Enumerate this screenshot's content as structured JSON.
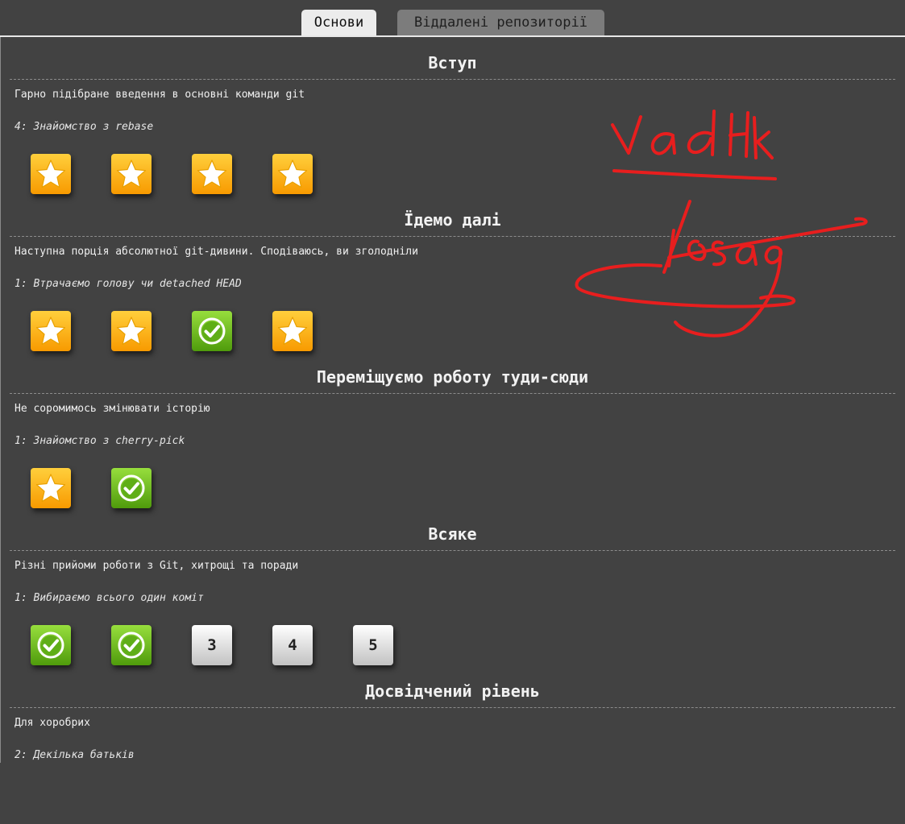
{
  "tabs": [
    {
      "label": "Основи",
      "active": true
    },
    {
      "label": "Віддалені репозиторії",
      "active": false
    }
  ],
  "sections": [
    {
      "title": "Вступ",
      "description": "Гарно підібране введення в основні команди git",
      "current_level": "4: Знайомство з rebase",
      "levels": [
        {
          "state": "star",
          "icon": "star-icon"
        },
        {
          "state": "star",
          "icon": "star-icon"
        },
        {
          "state": "star",
          "icon": "star-icon"
        },
        {
          "state": "star",
          "icon": "star-icon"
        }
      ]
    },
    {
      "title": "Їдемо далі",
      "description": "Наступна порція абсолютної git-дивини. Сподіваюсь, ви зголодніли",
      "current_level": "1: Втрачаємо голову чи detached HEAD",
      "levels": [
        {
          "state": "star",
          "icon": "star-icon"
        },
        {
          "state": "star",
          "icon": "star-icon"
        },
        {
          "state": "done",
          "icon": "checkmark-icon"
        },
        {
          "state": "star",
          "icon": "star-icon"
        }
      ]
    },
    {
      "title": "Переміщуємо роботу туди-сюди",
      "description": "Не соромимось змінювати історію",
      "current_level": "1: Знайомство з cherry-pick",
      "levels": [
        {
          "state": "star",
          "icon": "star-icon"
        },
        {
          "state": "done",
          "icon": "checkmark-icon"
        }
      ]
    },
    {
      "title": "Всяке",
      "description": "Різні прийоми роботи з Git, хитрощі та поради",
      "current_level": "1: Вибираємо всього один коміт",
      "levels": [
        {
          "state": "done",
          "icon": "checkmark-icon"
        },
        {
          "state": "done",
          "icon": "checkmark-icon"
        },
        {
          "state": "num",
          "label": "3"
        },
        {
          "state": "num",
          "label": "4"
        },
        {
          "state": "num",
          "label": "5"
        }
      ]
    },
    {
      "title": "Досвідчений рівень",
      "description": "Для хоробрих",
      "current_level": "2: Декілька батьків",
      "levels": []
    }
  ],
  "annotation": {
    "text": "Vadkk",
    "color": "#e81e1e"
  },
  "colors": {
    "background": "#424242",
    "star_tile": "#fdb51e",
    "done_tile": "#6fbf22",
    "number_tile": "#e2e2e2"
  }
}
